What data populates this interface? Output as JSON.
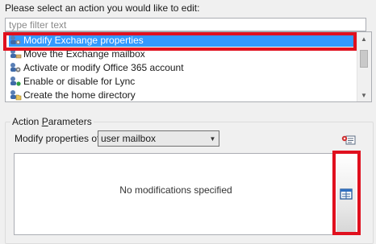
{
  "prompt": "Please select an action you would like to edit:",
  "filter": {
    "value": "",
    "placeholder": "type filter text"
  },
  "actions": [
    {
      "label": "Modify Exchange properties",
      "icon": "exchange-gear-icon",
      "selected": true
    },
    {
      "label": "Move the Exchange mailbox",
      "icon": "mailbox-move-icon",
      "selected": false
    },
    {
      "label": "Activate or modify Office 365 account",
      "icon": "office365-account-icon",
      "selected": false
    },
    {
      "label": "Enable or disable for Lync",
      "icon": "lync-user-icon",
      "selected": false
    },
    {
      "label": "Create the home directory",
      "icon": "home-directory-icon",
      "selected": false
    }
  ],
  "action_parameters": {
    "group_title_prefix": "Action ",
    "group_title_accel": "P",
    "group_title_suffix": "arameters",
    "modify_label": "Modify properties of",
    "object_type": "user mailbox",
    "empty_text": "No modifications specified"
  },
  "colors": {
    "selection": "#3399ff",
    "highlight_frame": "#e0101e",
    "window_bg": "#f0f0f0"
  }
}
